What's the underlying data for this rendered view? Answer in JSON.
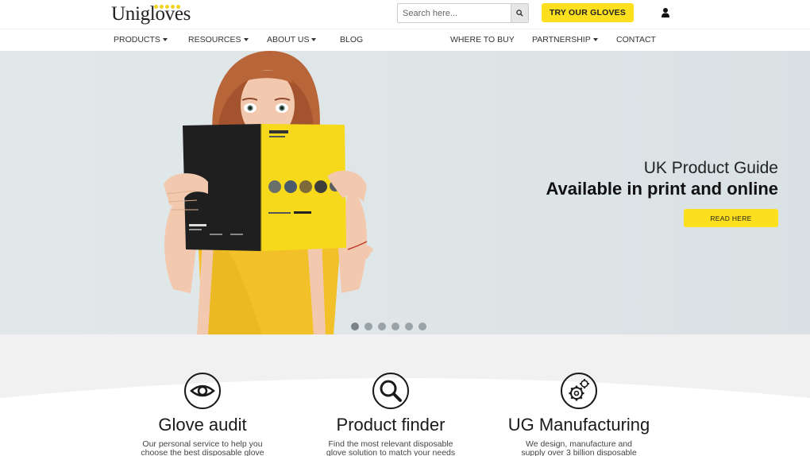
{
  "header": {
    "logo_text": "Unigloves",
    "search_placeholder": "Search here...",
    "try_button": "TRY OUR GLOVES"
  },
  "nav": {
    "products": "PRODUCTS",
    "resources": "RESOURCES",
    "about_us": "ABOUT US",
    "blog": "BLOG",
    "where_to_buy": "WHERE TO BUY",
    "partnership": "PARTNERSHIP",
    "contact": "CONTACT"
  },
  "hero": {
    "line1": "UK Product Guide",
    "line2": "Available in print and online",
    "button": "READ HERE",
    "slide_count": 6,
    "active_slide": 1
  },
  "features": [
    {
      "title": "Glove audit",
      "desc_1": "Our personal service to help you",
      "desc_2": "choose the best disposable glove",
      "icon": "eye-icon"
    },
    {
      "title": "Product finder",
      "desc_1": "Find the most relevant disposable",
      "desc_2": "glove solution to match your needs",
      "icon": "magnifier-icon"
    },
    {
      "title": "UG Manufacturing",
      "desc_1": "We design, manufacture and",
      "desc_2": "supply over 3 billion disposable",
      "icon": "gears-icon"
    }
  ],
  "colors": {
    "accent_yellow": "#fde01d",
    "hero_background": "#dfe6e8",
    "section_background": "#f1f1f2"
  }
}
